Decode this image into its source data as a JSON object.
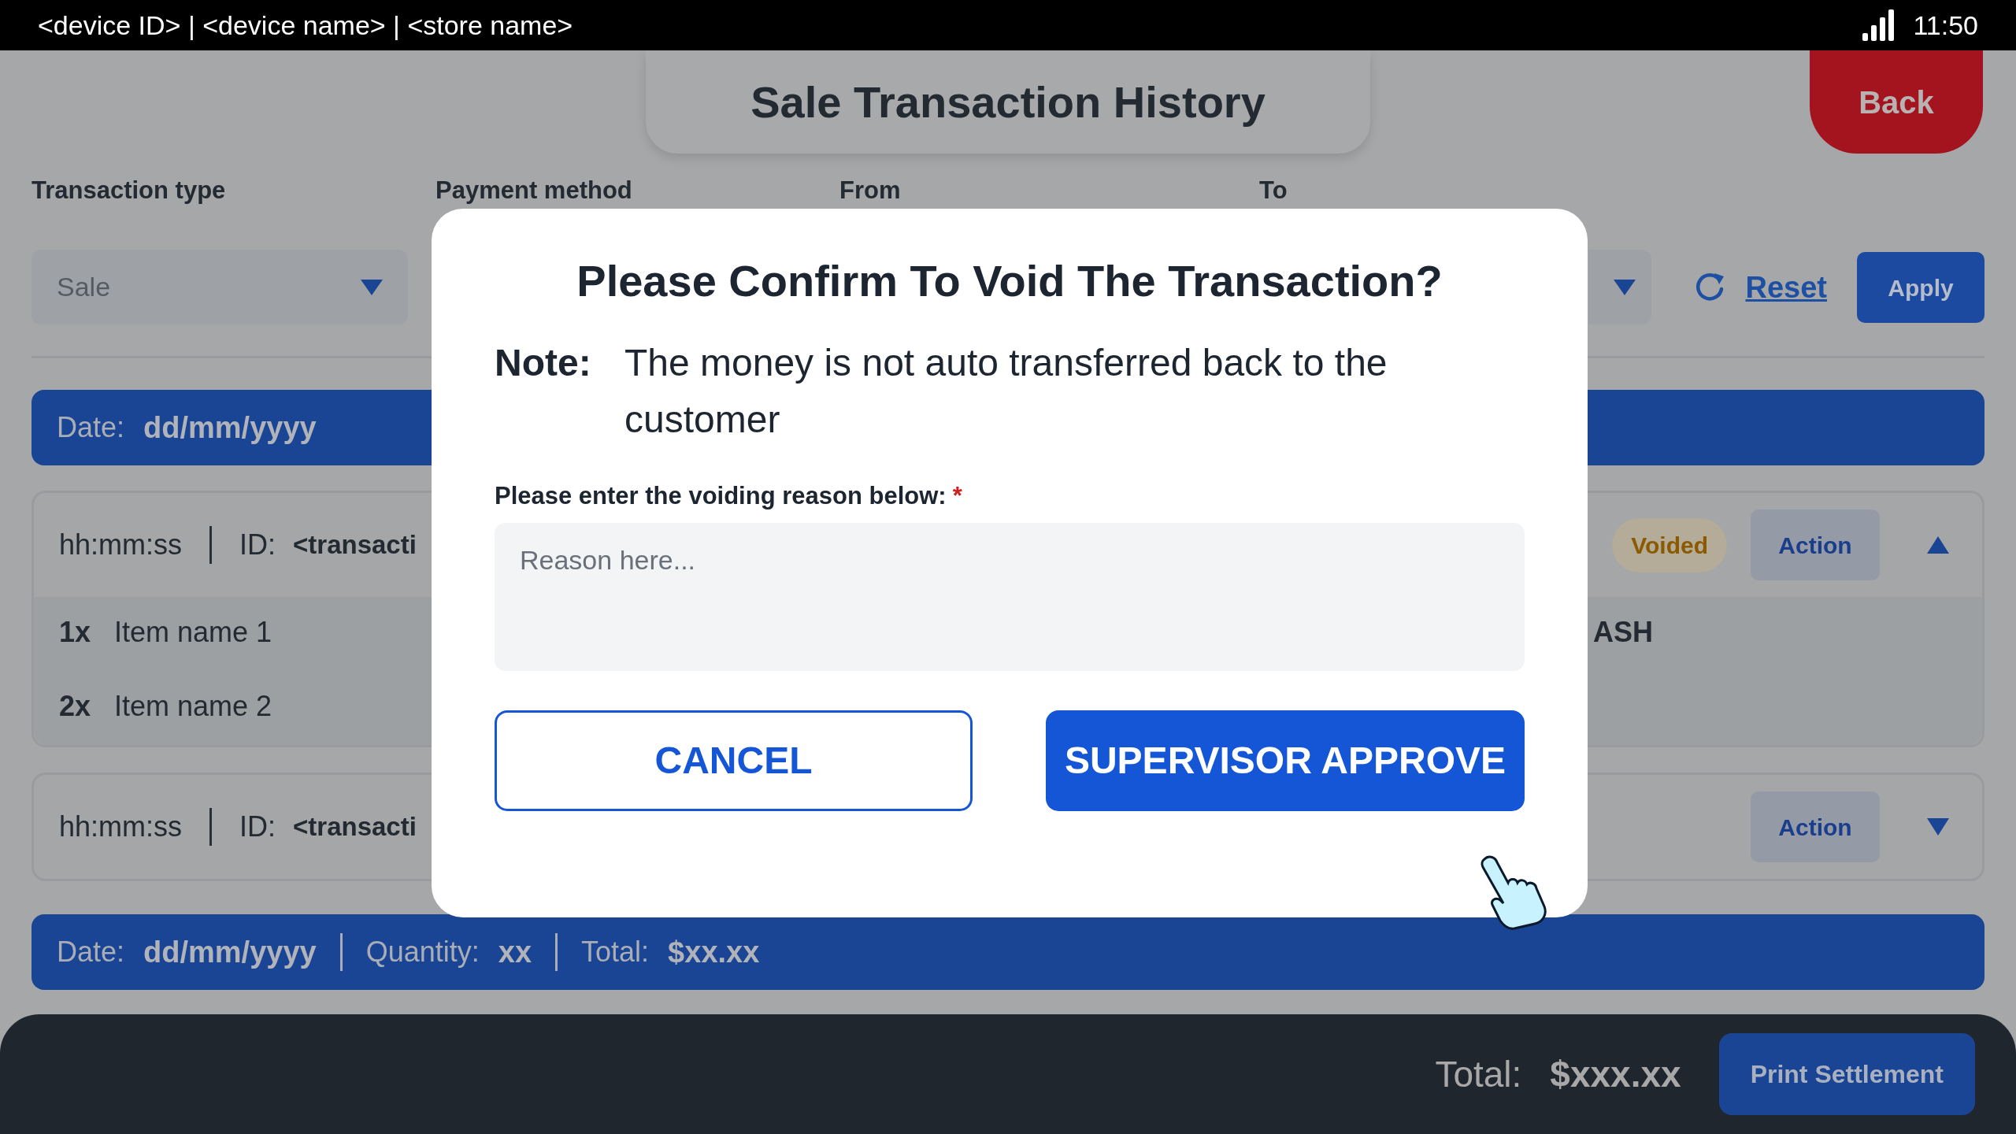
{
  "status_bar": {
    "device_text": "<device ID> | <device name> | <store name>",
    "time": "11:50"
  },
  "header": {
    "title": "Sale Transaction History",
    "back_button": "Back"
  },
  "filters": [
    {
      "label": "Transaction type",
      "value": "Sale"
    },
    {
      "label": "Payment method"
    },
    {
      "label": "From"
    },
    {
      "label": "To"
    }
  ],
  "filter_actions": {
    "reset": "Reset",
    "apply": "Apply"
  },
  "groups": [
    {
      "date_bar": [
        {
          "label": "Date:",
          "value": "dd/mm/yyyy"
        }
      ],
      "transactions": [
        {
          "time": "hh:mm:ss",
          "id_label": "ID:",
          "id": "<transacti",
          "status": "Voided",
          "action": "Action",
          "expanded": true,
          "items": [
            {
              "qty": "1x",
              "name": "Item name 1"
            },
            {
              "qty": "2x",
              "name": "Item name 2"
            }
          ],
          "payment": "ASH"
        },
        {
          "time": "hh:mm:ss",
          "id_label": "ID:",
          "id": "<transacti",
          "action": "Action",
          "expanded": false
        }
      ]
    },
    {
      "date_bar": [
        {
          "label": "Date:",
          "value": "dd/mm/yyyy"
        },
        {
          "label": "Quantity:",
          "value": "xx"
        },
        {
          "label": "Total:",
          "value": "$xx.xx"
        }
      ]
    }
  ],
  "footer": {
    "total_label": "Total:",
    "total": "$xxx.xx",
    "print_button": "Print Settlement"
  },
  "dialog": {
    "title": "Please Confirm To Void The Transaction?",
    "note_label": "Note:",
    "note": "The money is not auto transferred back to the customer",
    "reason_label": "Please enter the voiding reason below:",
    "required_mark": "*",
    "placeholder": "Reason here...",
    "cancel": "CANCEL",
    "approve": "SUPERVISOR APPROVE"
  }
}
